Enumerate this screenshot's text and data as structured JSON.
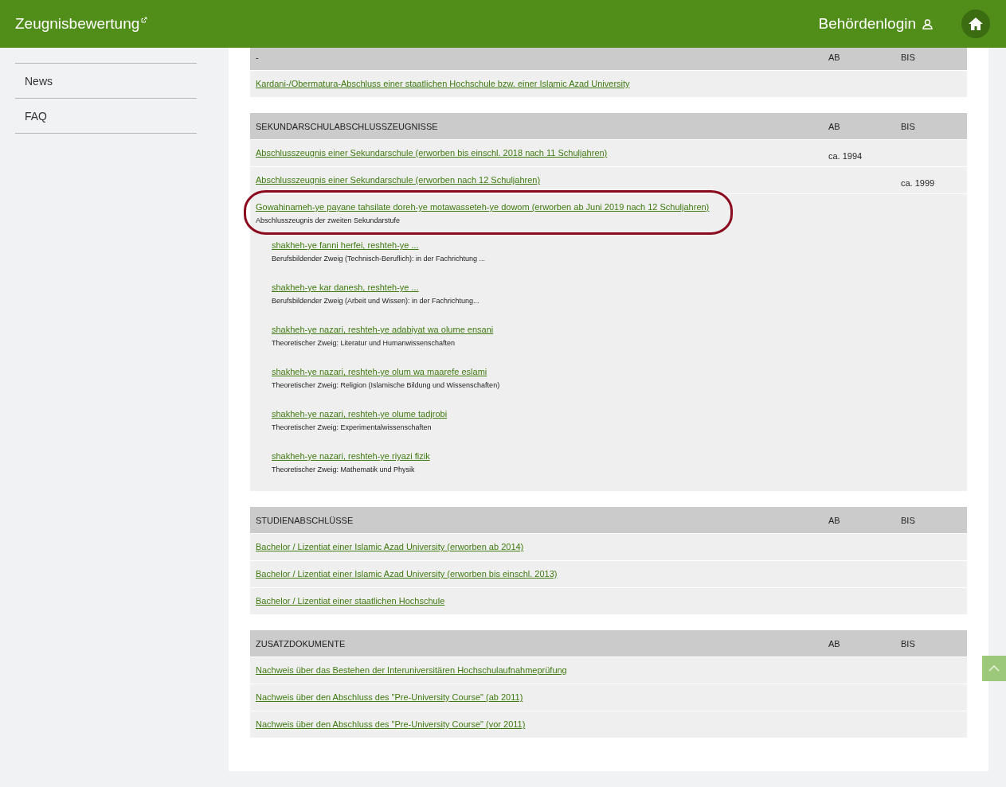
{
  "header": {
    "title": "Zeugnisbewertung",
    "login": "Behördenlogin"
  },
  "sidebar": {
    "items": [
      "News",
      "FAQ"
    ]
  },
  "sections": [
    {
      "title": "-",
      "col_ab": "AB",
      "col_bis": "BIS",
      "rows": [
        {
          "link": "Kardani-/Obermatura-Abschluss einer staatlichen Hochschule bzw. einer Islamic Azad University"
        }
      ]
    },
    {
      "title": "SEKUNDARSCHULABSCHLUSSZEUGNISSE",
      "col_ab": "AB",
      "col_bis": "BIS",
      "rows": [
        {
          "link": "Abschlusszeugnis einer Sekundarschule (erworben bis einschl. 2018 nach 11 Schuljahren)",
          "ab": "ca. 1994"
        },
        {
          "link": "Abschlusszeugnis einer Sekundarschule (erworben nach 12 Schuljahren)",
          "bis": "ca. 1999"
        },
        {
          "link": "Gowahinameh-ye payane tahsilate doreh-ye motawasseteh-ye dowom (erworben ab Juni 2019 nach 12 Schuljahren)",
          "note": "Abschlusszeugnis der zweiten Sekundarstufe",
          "highlighted": true,
          "children": [
            {
              "link": "shakheh-ye fanni herfei, reshteh-ye ...",
              "note": "Berufsbildender Zweig (Technisch-Beruflich): in der Fachrichtung ..."
            },
            {
              "link": "shakheh-ye kar danesh, reshteh-ye ...",
              "note": "Berufsbildender Zweig (Arbeit und Wissen): in der Fachrichtung..."
            },
            {
              "link": "shakheh-ye nazari, reshteh-ye adabiyat wa olume ensani",
              "note": "Theoretischer Zweig: Literatur und Humanwissenschaften"
            },
            {
              "link": "shakheh-ye nazari, reshteh-ye olum wa maarefe eslami",
              "note": "Theoretischer Zweig: Religion (Islamische Bildung und Wissenschaften)"
            },
            {
              "link": "shakheh-ye nazari, reshteh-ye olume tadjrobi",
              "note": "Theoretischer Zweig: Experimentalwissenschaften"
            },
            {
              "link": "shakheh-ye nazari, reshteh-ye riyazi fizik",
              "note": "Theoretischer Zweig: Mathematik und Physik"
            }
          ]
        }
      ]
    },
    {
      "title": "STUDIENABSCHLÜSSE",
      "col_ab": "AB",
      "col_bis": "BIS",
      "rows": [
        {
          "link": "Bachelor / Lizentiat einer Islamic Azad University (erworben ab 2014)"
        },
        {
          "link": "Bachelor / Lizentiat einer Islamic Azad University (erworben bis einschl. 2013)"
        },
        {
          "link": "Bachelor / Lizentiat einer staatlichen Hochschule"
        }
      ]
    },
    {
      "title": "ZUSATZDOKUMENTE",
      "col_ab": "AB",
      "col_bis": "BIS",
      "rows": [
        {
          "link": "Nachweis über das Bestehen der Interuniversitären Hochschulaufnahmeprüfung"
        },
        {
          "link": "Nachweis über den Abschluss des \"Pre-University Course\" (ab 2011)"
        },
        {
          "link": "Nachweis über den Abschluss des \"Pre-University Course\" (vor 2011)"
        }
      ]
    }
  ]
}
